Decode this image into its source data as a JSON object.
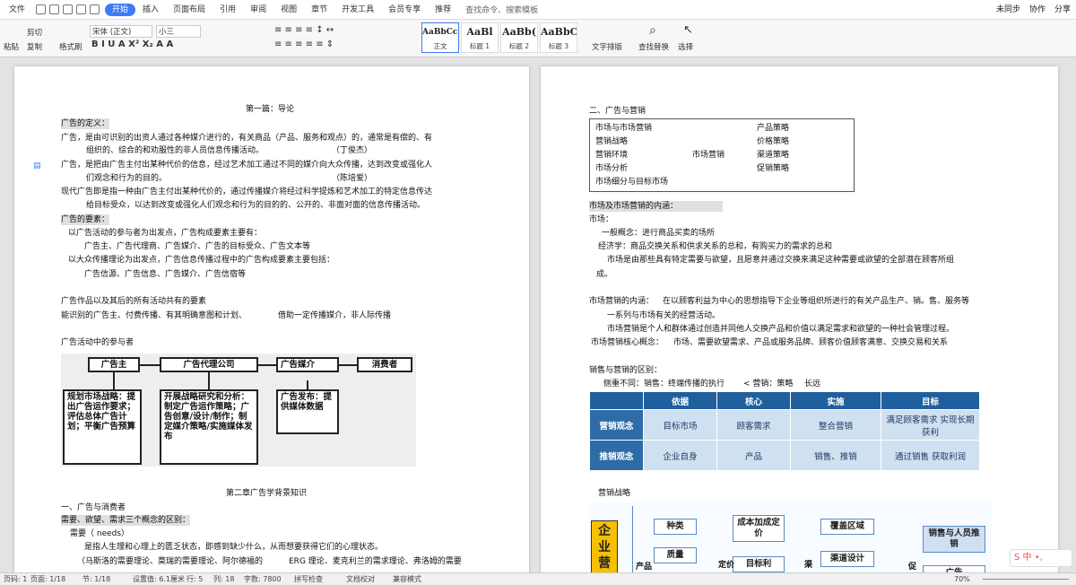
{
  "topbar": {
    "menu": "文件",
    "tabs": [
      "开始",
      "插入",
      "页面布局",
      "引用",
      "审阅",
      "视图",
      "章节",
      "开发工具",
      "会员专享",
      "推荐"
    ],
    "active_tab": "开始",
    "search": "查找命令、搜索模板",
    "right": [
      "未同步",
      "协作",
      "分享"
    ]
  },
  "ribbon": {
    "paste": "粘贴",
    "cut": "剪切",
    "copy": "复制",
    "format_painter": "格式刷",
    "font": "宋体 (正文)",
    "size": "小三",
    "styles": [
      {
        "preview": "AaBbCcI",
        "label": "正文"
      },
      {
        "preview": "AaBl",
        "label": "标题 1"
      },
      {
        "preview": "AaBb(",
        "label": "标题 2"
      },
      {
        "preview": "AaBbC",
        "label": "标题 3"
      }
    ],
    "text_layout": "文字排版",
    "find_replace": "查找替换",
    "select": "选择"
  },
  "left_page": {
    "title": "第一篇：导论",
    "def_header": "广告的定义：",
    "def1a": "广告，是由可识别的出资人通过各种媒介进行的，有关商品（产品、服务和观点）的，通常是有偿的、有",
    "def1b": "组织的、综合的和劝服性的非人员信息传播活动。",
    "def1c": "（丁俊杰）",
    "def2a": "广告，是把由广告主付出某种代价的信息，经过艺术加工通过不同的媒介向大众传播，达到改变或强化人",
    "def2b": "们观念和行为的目的。",
    "def2c": "（陈培爱）",
    "def3a": "现代广告即是指一种由广告主付出某种代价的，通过传播媒介将经过科学提炼和艺术加工的特定信息传达",
    "def3b": "给目标受众，以达到改变或强化人们观念和行为的目的的、公开的、非面对面的信息传播活动。",
    "elements_header": "广告的要素：",
    "el1": "以广告活动的参与者为出发点，广告构成要素主要有：",
    "el2": "广告主、广告代理商、广告媒介、广告的目标受众、广告文本等",
    "el3": "以大众传播理论为出发点，广告信息传播过程中的广告构成要素主要包括：",
    "el4": "广告信源、广告信息、广告媒介、广告信宿等",
    "works1": "广告作品以及其后的所有活动共有的要素",
    "works2a": "能识别的广告主、付费传播、有其明确意图和计划、",
    "works2b": "借助一定传播媒介，非人际传播",
    "participants": "广告活动中的参与者",
    "flow_heads": [
      "广告主",
      "广告代理公司",
      "广告媒介",
      "消费者"
    ],
    "flow_boxes": [
      "规划市场战略：提出广告运作要求；评估总体广告计划；平衡广告预算",
      "开展战略研究和分析：制定广告运作策略；广告创意/设计/制作；制定媒介策略/实施媒体发布",
      "广告发布：提供媒体数据"
    ],
    "ch2_title": "第二章广告学背景知识",
    "ch2_s1": "一、广告与消费者",
    "ch2_s2": "需要、欲望、需求三个概念的区别：",
    "ch2_s3": "需要（ needs）",
    "ch2_s4": "是指人生理和心理上的匮乏状态，即感到缺少什么，从而想要获得它们的心理状态。",
    "ch2_s5a": "（马斯洛的需要理论、莫瑞的需要理论、阿尔德福的",
    "ch2_s5b": "ERG 理论、麦克利兰的需求理论、弗洛姆的需要"
  },
  "right_page": {
    "sec": "二、广告与营销",
    "box_left": [
      "市场与市场营销",
      "营销战略",
      "营销环境",
      "市场分析",
      "市场细分与目标市场"
    ],
    "box_mid": "市场营销",
    "box_right": [
      "产品策略",
      "价格策略",
      "渠道策略",
      "促销策略"
    ],
    "content_header": "市场及市场营销的内涵：",
    "market": "市场：",
    "m1": "一般概念：进行商品买卖的场所",
    "m2": "经济学：商品交换关系和供求关系的总和，有购买力的需求的总和",
    "m3": "市场是由那些具有特定需要与欲望，且愿意并通过交换来满足这种需要或欲望的全部潜在顾客所组",
    "m4": "成。",
    "mk1a": "市场营销的内涵：",
    "mk1b": "在以顾客利益为中心的思想指导下企业等组织所进行的有关产品生产、销。售、服务等",
    "mk2": "一系列与市场有关的经营活动。",
    "mk3": "市场营销是个人和群体通过创造并同他人交换产品和价值以满足需求和欲望的一种社会管理过程。",
    "mk4a": "市场营销核心概念：",
    "mk4b": "市场、需要欲望需求、产品或服务品牌、顾客价值顾客满意、交换交易和关系",
    "diff": "销售与营销的区别：",
    "diff2a": "侧重不同：销售：终端传播的执行",
    "diff2b": "<  营销：策略",
    "diff2c": "长远",
    "table_head": [
      "",
      "依据",
      "核心",
      "实施",
      "目标"
    ],
    "table_rows": [
      [
        "营销观念",
        "目标市场",
        "顾客需求",
        "整合营销",
        "满足顾客需求 实现长期获利"
      ],
      [
        "推销观念",
        "企业自身",
        "产品",
        "销售、推销",
        "通过销售 获取利润"
      ]
    ],
    "strategy": "营销战略",
    "strategy_boxes": [
      "企业营",
      "产品",
      "种类",
      "质量",
      "成本加成定价",
      "目标利",
      "定价",
      "覆盖区域",
      "渠道设计",
      "渠",
      "促",
      "销售与人员推销",
      "广告"
    ]
  },
  "status": {
    "page": "页码: 1",
    "pages": "页面: 1/18",
    "section": "节: 1/18",
    "setting": "设置值: 6.1厘米",
    "row": "行: 5",
    "col": "列: 18",
    "words": "字数: 7800",
    "spell": "拼写检查",
    "proof": "文档校对",
    "compat": "兼容模式",
    "zoom": "70%"
  }
}
